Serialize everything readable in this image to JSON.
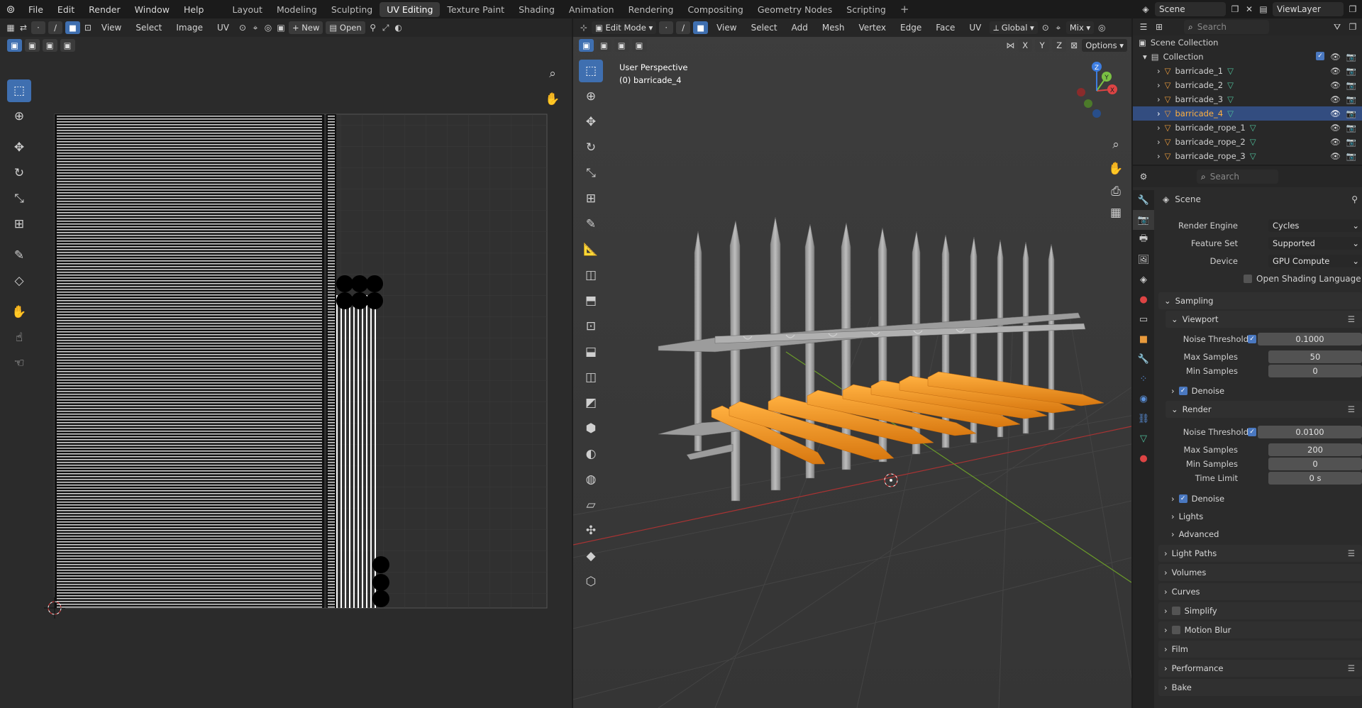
{
  "topbar": {
    "menus": [
      "File",
      "Edit",
      "Render",
      "Window",
      "Help"
    ],
    "workspaces": [
      "Layout",
      "Modeling",
      "Sculpting",
      "UV Editing",
      "Texture Paint",
      "Shading",
      "Animation",
      "Rendering",
      "Compositing",
      "Geometry Nodes",
      "Scripting"
    ],
    "active_workspace": "UV Editing",
    "plus": "+",
    "scene": "Scene",
    "view_layer": "ViewLayer"
  },
  "uv_editor": {
    "menus": [
      "View",
      "Select",
      "Image",
      "UV"
    ],
    "new_label": "New",
    "open_label": "Open"
  },
  "viewport": {
    "mode": "Edit Mode",
    "menus": [
      "View",
      "Select",
      "Add",
      "Mesh",
      "Vertex",
      "Edge",
      "Face",
      "UV"
    ],
    "orientation": "Global",
    "shading": "Mix",
    "options": "Options",
    "axes": [
      "X",
      "Y",
      "Z"
    ],
    "overlay_line1": "User Perspective",
    "overlay_line2": "(0) barricade_4",
    "gizmo_x": "X",
    "gizmo_y": "Y",
    "gizmo_z": "Z"
  },
  "outliner": {
    "search_placeholder": "Search",
    "scene_collection": "Scene Collection",
    "collection": "Collection",
    "items": [
      "barricade_1",
      "barricade_2",
      "barricade_3",
      "barricade_4",
      "barricade_rope_1",
      "barricade_rope_2",
      "barricade_rope_3"
    ],
    "selected": "barricade_4"
  },
  "properties": {
    "search_placeholder": "Search",
    "context": "Scene",
    "render_engine_label": "Render Engine",
    "render_engine": "Cycles",
    "feature_set_label": "Feature Set",
    "feature_set": "Supported",
    "device_label": "Device",
    "device": "GPU Compute",
    "osl_label": "Open Shading Language",
    "sampling": "Sampling",
    "viewport": "Viewport",
    "noise_threshold_label": "Noise Threshold",
    "vp_noise_threshold": "0.1000",
    "max_samples_label": "Max Samples",
    "vp_max_samples": "50",
    "min_samples_label": "Min Samples",
    "vp_min_samples": "0",
    "denoise_label": "Denoise",
    "render": "Render",
    "r_noise_threshold": "0.0100",
    "r_max_samples": "200",
    "r_min_samples": "0",
    "time_limit_label": "Time Limit",
    "r_time_limit": "0 s",
    "lights": "Lights",
    "advanced": "Advanced",
    "light_paths": "Light Paths",
    "volumes": "Volumes",
    "curves": "Curves",
    "simplify": "Simplify",
    "motion_blur": "Motion Blur",
    "film": "Film",
    "performance": "Performance",
    "bake": "Bake"
  },
  "colors": {
    "accent": "#3f6fb0",
    "selected_mesh": "#f0901e",
    "mesh": "#a8a8a8"
  }
}
